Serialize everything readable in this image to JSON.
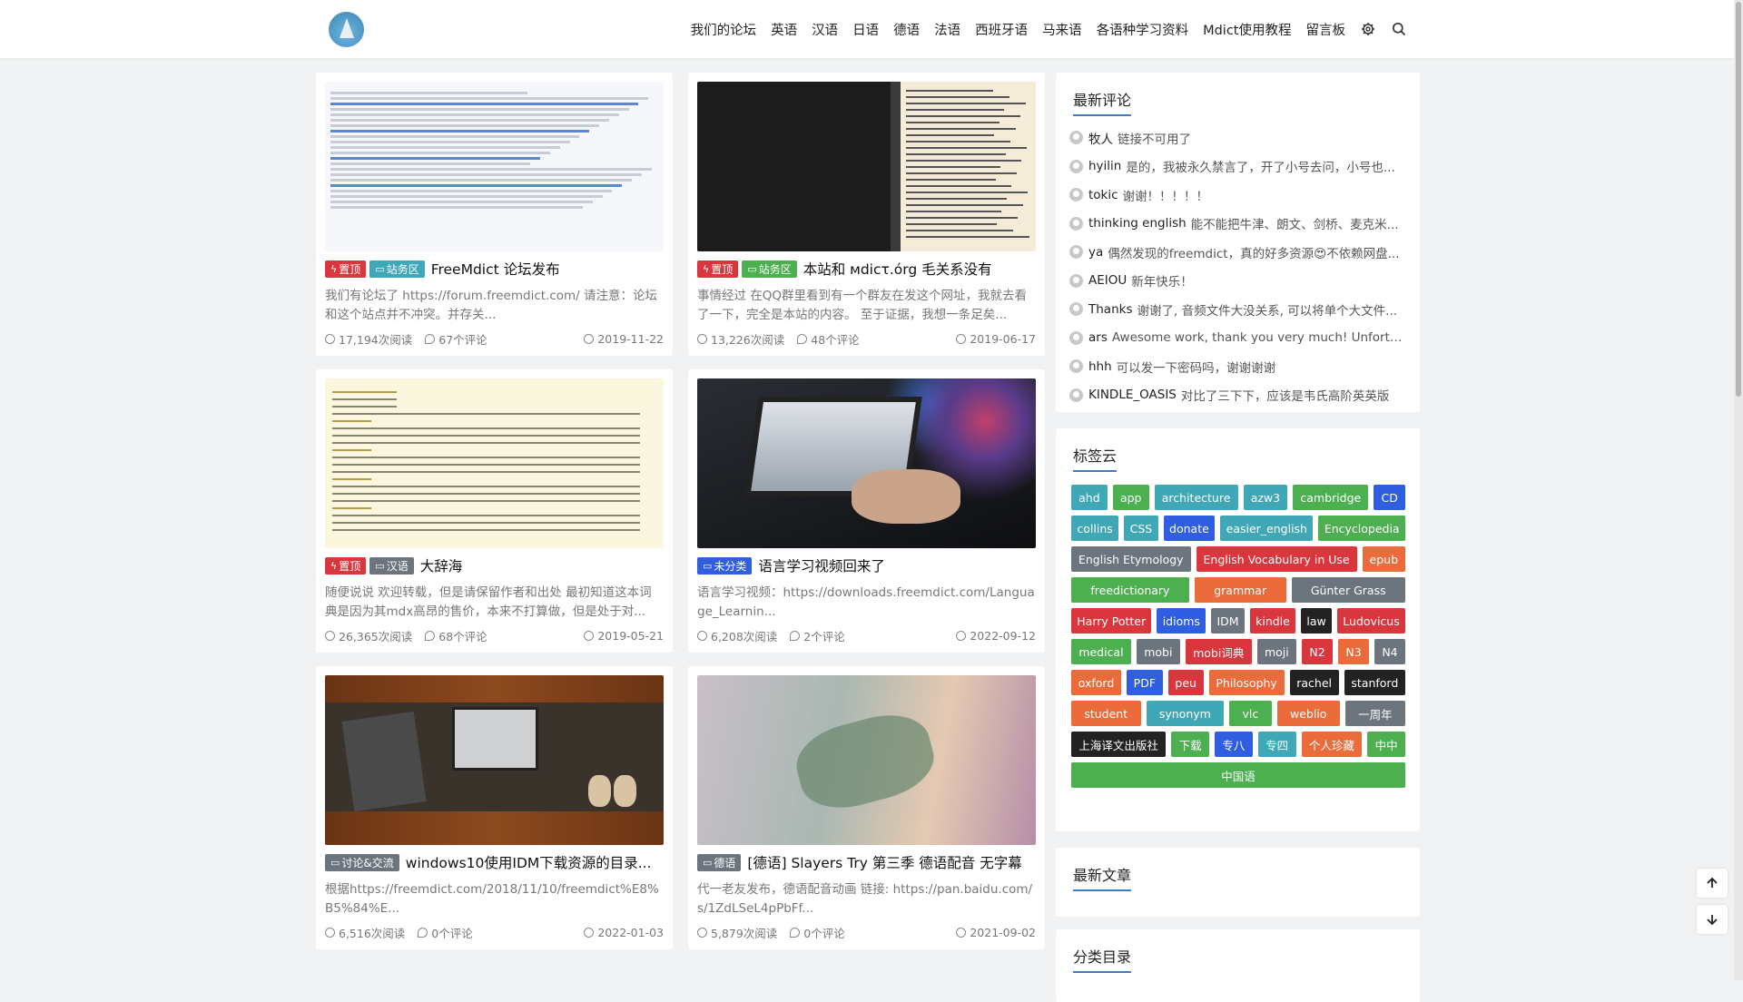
{
  "nav": {
    "items": [
      "我们的论坛",
      "英语",
      "汉语",
      "日语",
      "德语",
      "法语",
      "西班牙语",
      "马来语",
      "各语种学习资料",
      "Mdict使用教程",
      "留言板"
    ]
  },
  "posts": [
    {
      "badges": [
        {
          "label": "置顶",
          "color": "red"
        },
        {
          "label": "站务区",
          "color": "teal"
        }
      ],
      "title": "FreeMdict 论坛发布",
      "excerpt": "我们有论坛了 https://forum.freemdict.com/ 请注意：论坛和这个站点并不冲突。并存关...",
      "views": "17,194次阅读",
      "comments": "67个评论",
      "date": "2019-11-22",
      "image": "screenshot"
    },
    {
      "badges": [
        {
          "label": "置顶",
          "color": "red"
        },
        {
          "label": "站务区",
          "color": "green"
        }
      ],
      "title": "本站和 мdісτ.órg 毛关系没有",
      "excerpt": "事情经过 在QQ群里看到有一个群友在发这个网址，我就去看了一下，完全是本站的内容。 至于证据，我想一条足矣...",
      "views": "13,226次阅读",
      "comments": "48个评论",
      "date": "2019-06-17",
      "image": "japanese"
    },
    {
      "badges": [
        {
          "label": "置顶",
          "color": "red"
        },
        {
          "label": "汉语",
          "color": "gray"
        }
      ],
      "title": "大辞海",
      "excerpt": "随便说说 欢迎转载，但是请保留作者和出处 最初知道这本词典是因为其mdx高昂的售价，本来不打算做，但是处于对...",
      "views": "26,365次阅读",
      "comments": "68个评论",
      "date": "2019-05-21",
      "image": "dict"
    },
    {
      "badges": [
        {
          "label": "未分类",
          "color": "blue"
        }
      ],
      "title": "语言学习视频回来了",
      "excerpt": "语言学习视频：https://downloads.freemdict.com/Language_Learnin...",
      "views": "6,208次阅读",
      "comments": "2个评论",
      "date": "2022-09-12",
      "image": "laptop"
    },
    {
      "badges": [
        {
          "label": "讨论&交流",
          "color": "gray"
        }
      ],
      "title": "windows10使用IDM下载资源的目录...",
      "excerpt": "根据https://freemdict.com/2018/11/10/freemdict%E8%B5%84%E...",
      "views": "6,516次阅读",
      "comments": "0个评论",
      "date": "2022-01-03",
      "image": "sofa"
    },
    {
      "badges": [
        {
          "label": "德语",
          "color": "gray"
        }
      ],
      "title": "[德语] Slayers Try 第三季 德语配音 无字幕",
      "excerpt": "代一老友发布，德语配音动画 链接: https://pan.baidu.com/s/1ZdLSeL4pPbFf...",
      "views": "5,879次阅读",
      "comments": "0个评论",
      "date": "2021-09-02",
      "image": "anime"
    }
  ],
  "comments_widget": {
    "title": "最新评论",
    "items": [
      {
        "name": "牧人",
        "text": "链接不可用了"
      },
      {
        "name": "hyilin",
        "text": "是的，我被永久禁言了，开了小号去问，小号也..."
      },
      {
        "name": "tokic",
        "text": "谢谢！！！！！"
      },
      {
        "name": "thinking english",
        "text": "能不能把牛津、朗文、剑桥、麦克米..."
      },
      {
        "name": "ya",
        "text": "偶然发现的freemdict，真的好多资源😍不依赖网盘..."
      },
      {
        "name": "AEIOU",
        "text": "新年快乐！"
      },
      {
        "name": "Thanks",
        "text": "谢谢了, 音频文件大没关系, 可以将单个大文件..."
      },
      {
        "name": "ars",
        "text": "Awesome work, thank you very much! Unfortuna..."
      },
      {
        "name": "hhh",
        "text": "可以发一下密码吗，谢谢谢谢"
      },
      {
        "name": "KINDLE_OASIS",
        "text": "对比了三下下，应该是韦氏高阶英英版"
      }
    ]
  },
  "tags_widget": {
    "title": "标签云",
    "tags": [
      {
        "label": "ahd",
        "color": "#3fa7b5"
      },
      {
        "label": "app",
        "color": "#4caf50"
      },
      {
        "label": "architecture",
        "color": "#3fa7b5"
      },
      {
        "label": "azw3",
        "color": "#3fa7b5"
      },
      {
        "label": "cambridge",
        "color": "#4caf50"
      },
      {
        "label": "CD",
        "color": "#2f5fe0"
      },
      {
        "label": "collins",
        "color": "#3fa7b5"
      },
      {
        "label": "CSS",
        "color": "#3fa7b5"
      },
      {
        "label": "donate",
        "color": "#2f5fe0"
      },
      {
        "label": "easier_english",
        "color": "#3fa7b5"
      },
      {
        "label": "Encyclopedia",
        "color": "#4caf50"
      },
      {
        "label": "English Etymology",
        "color": "#6c757d"
      },
      {
        "label": "English Vocabulary in Use",
        "color": "#d9363e"
      },
      {
        "label": "epub",
        "color": "#ec6b3a"
      },
      {
        "label": "freedictionary",
        "color": "#4caf50"
      },
      {
        "label": "grammar",
        "color": "#ec6b3a"
      },
      {
        "label": "Günter Grass",
        "color": "#6c757d"
      },
      {
        "label": "Harry Potter",
        "color": "#d9363e"
      },
      {
        "label": "idioms",
        "color": "#2f5fe0"
      },
      {
        "label": "IDM",
        "color": "#6c757d"
      },
      {
        "label": "kindle",
        "color": "#d9363e"
      },
      {
        "label": "law",
        "color": "#222222"
      },
      {
        "label": "Ludovicus",
        "color": "#d9363e"
      },
      {
        "label": "medical",
        "color": "#4caf50"
      },
      {
        "label": "mobi",
        "color": "#6c757d"
      },
      {
        "label": "mobi词典",
        "color": "#d9363e"
      },
      {
        "label": "moji",
        "color": "#6c757d"
      },
      {
        "label": "N2",
        "color": "#d9363e"
      },
      {
        "label": "N3",
        "color": "#ec6b3a"
      },
      {
        "label": "N4",
        "color": "#6c757d"
      },
      {
        "label": "oxford",
        "color": "#ec6b3a"
      },
      {
        "label": "PDF",
        "color": "#2f5fe0"
      },
      {
        "label": "peu",
        "color": "#d9363e"
      },
      {
        "label": "Philosophy",
        "color": "#ec6b3a"
      },
      {
        "label": "rachel",
        "color": "#222222"
      },
      {
        "label": "stanford",
        "color": "#222222"
      },
      {
        "label": "student",
        "color": "#ec6b3a"
      },
      {
        "label": "synonym",
        "color": "#3fa7b5"
      },
      {
        "label": "vlc",
        "color": "#4caf50"
      },
      {
        "label": "weblio",
        "color": "#ec6b3a"
      },
      {
        "label": "一周年",
        "color": "#6c757d"
      },
      {
        "label": "上海译文出版社",
        "color": "#222222"
      },
      {
        "label": "下载",
        "color": "#4caf50"
      },
      {
        "label": "专八",
        "color": "#2f5fe0"
      },
      {
        "label": "专四",
        "color": "#3fa7b5"
      },
      {
        "label": "个人珍藏",
        "color": "#ec6b3a"
      },
      {
        "label": "中中",
        "color": "#4caf50"
      },
      {
        "label": "中国语",
        "color": "#4caf50"
      }
    ]
  },
  "recent_widget": {
    "title": "最新文章"
  },
  "category_widget": {
    "title": "分类目录"
  }
}
